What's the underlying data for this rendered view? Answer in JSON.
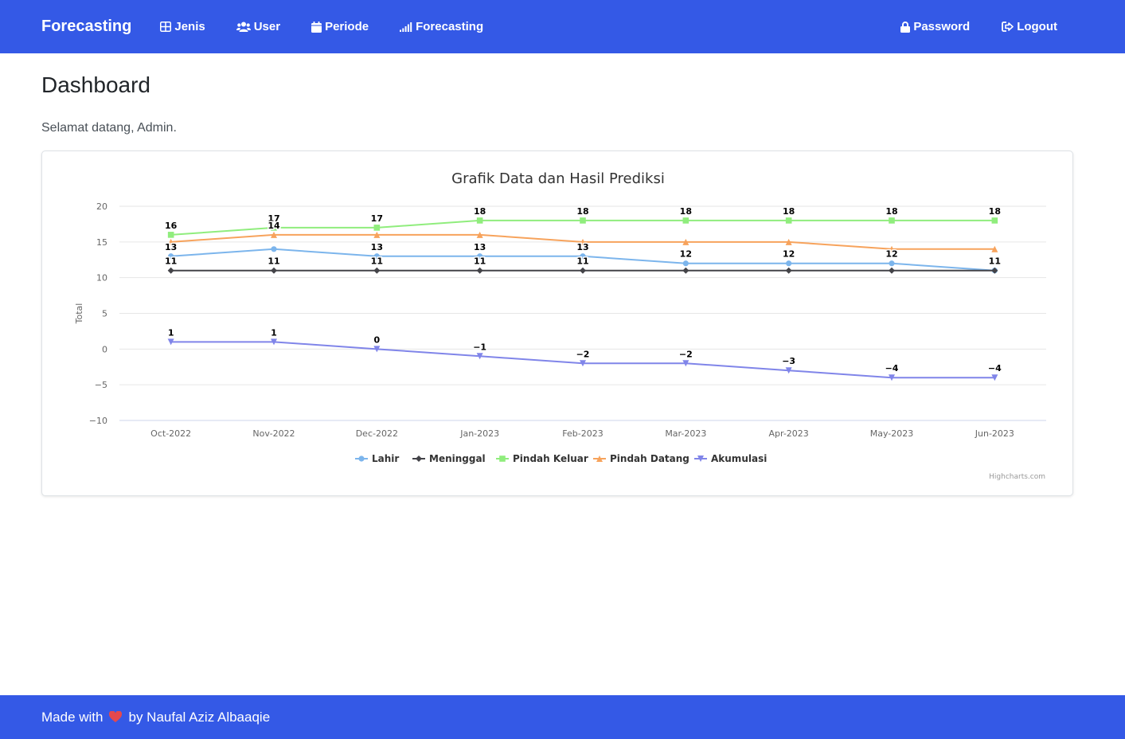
{
  "navbar": {
    "brand": "Forecasting",
    "menu": [
      {
        "label": "Jenis",
        "icon": "table-icon"
      },
      {
        "label": "User",
        "icon": "users-icon"
      },
      {
        "label": "Periode",
        "icon": "calendar-icon"
      },
      {
        "label": "Forecasting",
        "icon": "signal-icon"
      }
    ],
    "right": [
      {
        "label": "Password",
        "icon": "lock-icon"
      },
      {
        "label": "Logout",
        "icon": "logout-icon"
      }
    ]
  },
  "page": {
    "title": "Dashboard",
    "welcome": "Selamat datang, Admin."
  },
  "chart_data": {
    "type": "line",
    "title": "Grafik Data dan Hasil Prediksi",
    "xlabel": "",
    "ylabel": "Total",
    "ylim": [
      -10,
      20
    ],
    "yticks": [
      20,
      15,
      10,
      5,
      0,
      -5,
      -10
    ],
    "grid": true,
    "legend_position": "bottom-center",
    "credits": "Highcharts.com",
    "categories": [
      "Oct-2022",
      "Nov-2022",
      "Dec-2022",
      "Jan-2023",
      "Feb-2023",
      "Mar-2023",
      "Apr-2023",
      "May-2023",
      "Jun-2023"
    ],
    "series": [
      {
        "name": "Lahir",
        "color": "#7cb5ec",
        "marker": "circle",
        "values": [
          13,
          14,
          13,
          13,
          13,
          12,
          12,
          12,
          11
        ]
      },
      {
        "name": "Meninggal",
        "color": "#434348",
        "marker": "diamond",
        "values": [
          11,
          11,
          11,
          11,
          11,
          11,
          11,
          11,
          11
        ]
      },
      {
        "name": "Pindah Keluar",
        "color": "#90ed7d",
        "marker": "square",
        "values": [
          16,
          17,
          17,
          18,
          18,
          18,
          18,
          18,
          18
        ]
      },
      {
        "name": "Pindah Datang",
        "color": "#f7a35c",
        "marker": "triangle",
        "values": [
          15,
          16,
          16,
          16,
          15,
          15,
          15,
          14,
          14
        ]
      },
      {
        "name": "Akumulasi",
        "color": "#8085e9",
        "marker": "triangle-down",
        "values": [
          1,
          1,
          0,
          -1,
          -2,
          -2,
          -3,
          -4,
          -4
        ]
      }
    ],
    "data_labels": [
      {
        "series": "Pindah Keluar",
        "labels": [
          "16",
          "17",
          "17",
          "18",
          "18",
          "18",
          "18",
          "18",
          "18"
        ]
      },
      {
        "series": "Pindah Datang",
        "labels": [
          "",
          "14",
          "",
          "",
          "",
          "",
          "",
          "",
          ""
        ]
      },
      {
        "series": "Lahir",
        "labels": [
          "13",
          "",
          "13",
          "13",
          "13",
          "12",
          "12",
          "12",
          ""
        ]
      },
      {
        "series": "Meninggal",
        "labels": [
          "11",
          "11",
          "11",
          "11",
          "11",
          "",
          "",
          "",
          "11"
        ]
      },
      {
        "series": "Akumulasi",
        "labels": [
          "1",
          "1",
          "0",
          "−1",
          "−2",
          "−2",
          "−3",
          "−4",
          "−4"
        ]
      }
    ]
  },
  "footer": {
    "made_with": "Made with",
    "by": "by Naufal Aziz Albaaqie"
  }
}
